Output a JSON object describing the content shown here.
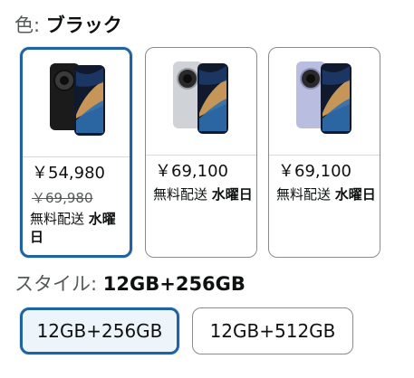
{
  "color_selector": {
    "label": "色: ",
    "selected_value": "ブラック"
  },
  "swatches": [
    {
      "image_icon": "smartphone-black-icon",
      "price": "￥54,980",
      "list_price": "￥69,980",
      "delivery_prefix": "無料配送 ",
      "delivery_day": "水曜日",
      "selected": true
    },
    {
      "image_icon": "smartphone-silver-icon",
      "price": "￥69,100",
      "delivery_prefix": "無料配送 ",
      "delivery_day": "水曜日",
      "selected": false
    },
    {
      "image_icon": "smartphone-lavender-icon",
      "price": "￥69,100",
      "delivery_prefix": "無料配送 ",
      "delivery_day": "水曜日",
      "selected": false
    }
  ],
  "style_selector": {
    "label": "スタイル: ",
    "selected_value": "12GB+256GB",
    "options": [
      {
        "label": "12GB+256GB",
        "selected": true
      },
      {
        "label": "12GB+512GB",
        "selected": false
      }
    ]
  },
  "colors": {
    "accent": "#2162a1",
    "selected_bg": "#edf5fb",
    "border": "#888c8c",
    "muted_text": "#565959"
  }
}
